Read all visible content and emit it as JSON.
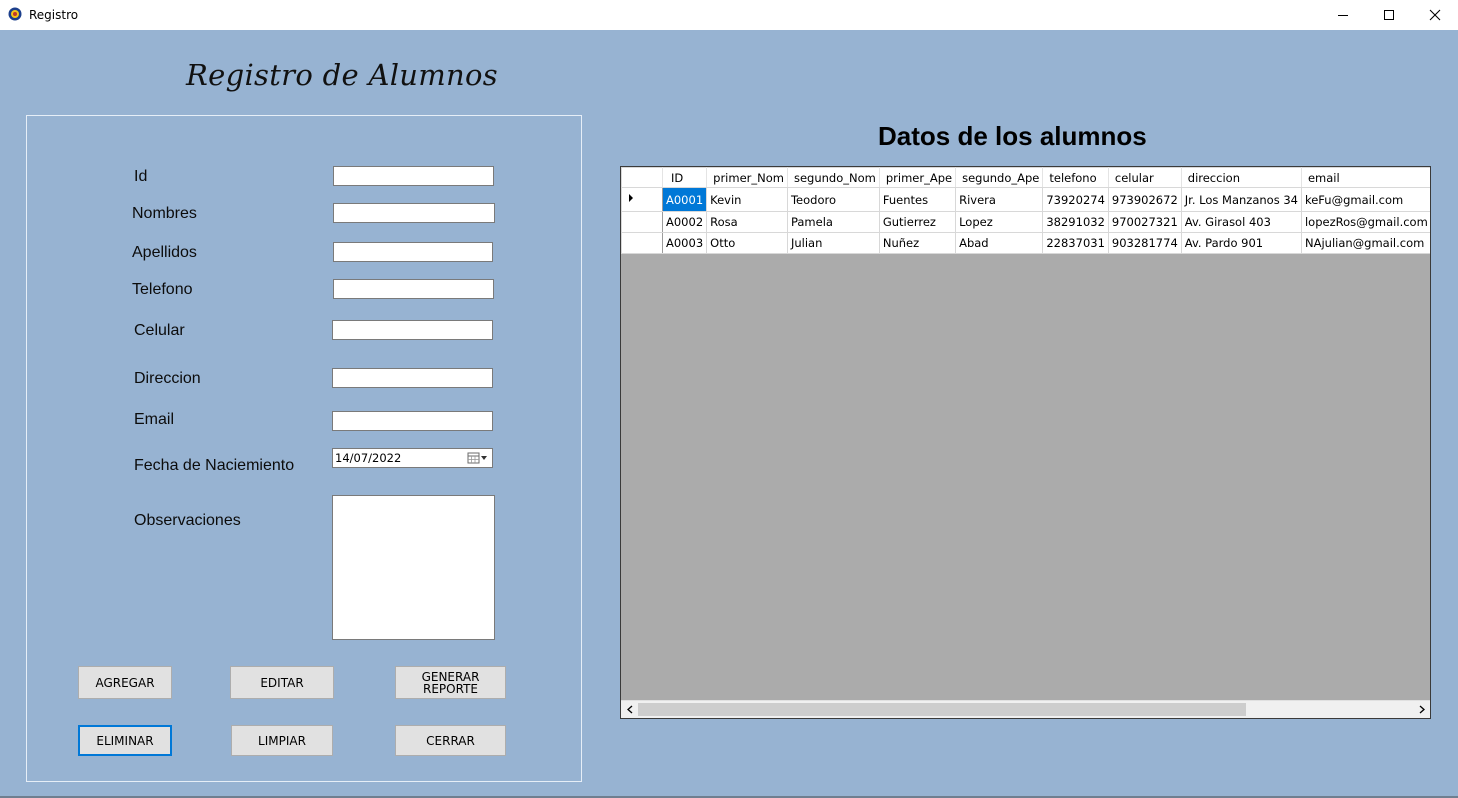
{
  "window": {
    "title": "Registro"
  },
  "form": {
    "title": "Registro de Alumnos",
    "labels": {
      "id": "Id",
      "nombres": "Nombres",
      "apellidos": "Apellidos",
      "telefono": "Telefono",
      "celular": "Celular",
      "direccion": "Direccion",
      "email": "Email",
      "fecha": "Fecha de Naciemiento",
      "observaciones": "Observaciones"
    },
    "values": {
      "id": "",
      "nombres": "",
      "apellidos": "",
      "telefono": "",
      "celular": "",
      "direccion": "",
      "email": "",
      "fecha": "14/07/2022",
      "observaciones": ""
    }
  },
  "buttons": {
    "agregar": "AGREGAR",
    "editar": "EDITAR",
    "generar_line1": "GENERAR",
    "generar_line2": "REPORTE",
    "eliminar": "ELIMINAR",
    "limpiar": "LIMPIAR",
    "cerrar": "CERRAR"
  },
  "grid": {
    "title": "Datos de los alumnos",
    "columns": [
      "ID",
      "primer_Nom",
      "segundo_Nom",
      "primer_Ape",
      "segundo_Ape",
      "telefono",
      "celular",
      "direccion",
      "email"
    ],
    "rows": [
      [
        "A0001",
        "Kevin",
        "Teodoro",
        "Fuentes",
        "Rivera",
        "73920274",
        "973902672",
        "Jr. Los Manzanos 34",
        "keFu@gmail.com"
      ],
      [
        "A0002",
        "Rosa",
        "Pamela",
        "Gutierrez",
        "Lopez",
        "38291032",
        "970027321",
        "Av. Girasol 403",
        "lopezRos@gmail.com"
      ],
      [
        "A0003",
        "Otto",
        "Julian",
        "Nuñez",
        "Abad",
        "22837031",
        "903281774",
        "Av. Pardo 901",
        "NAjulian@gmail.com"
      ]
    ],
    "colors": {
      "selected": "#0078d7",
      "empty_area": "#ababab"
    }
  },
  "colors": {
    "client_bg": "#97b3d2"
  }
}
